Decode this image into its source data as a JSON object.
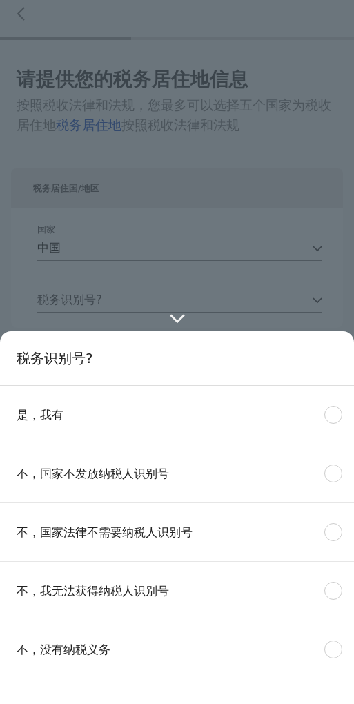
{
  "progress": {
    "level": 0.37
  },
  "title": "请提供您的税务居住地信息",
  "description": {
    "before": "按照税收法律和法规，您最多可以选择五个国家为税收居住地",
    "link": "税务居住地",
    "after": "按照税收法律和法规"
  },
  "card": {
    "header": "税务居住国/地区",
    "fields": [
      {
        "label": "国家",
        "value": "中国"
      },
      {
        "placeholder": "税务识别号?"
      }
    ]
  },
  "sheet": {
    "title": "税务识别号?",
    "options": [
      {
        "label": "是，我有",
        "selected": false
      },
      {
        "label": "不，国家不发放纳税人识别号",
        "selected": false
      },
      {
        "label": "不，国家法律不需要纳税人识别号",
        "selected": false
      },
      {
        "label": "不，我无法获得纳税人识别号",
        "selected": false
      },
      {
        "label": "不，没有纳税义务",
        "selected": false
      }
    ]
  }
}
